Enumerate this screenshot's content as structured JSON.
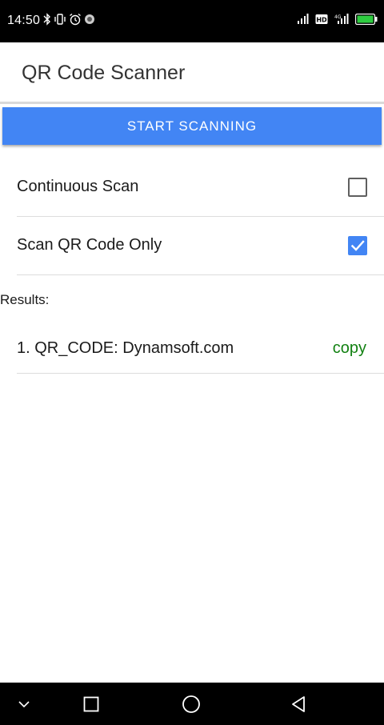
{
  "status_bar": {
    "time": "14:50",
    "left_icons": [
      "bluetooth-icon",
      "vibrate-icon",
      "alarm-icon",
      "record-icon"
    ],
    "right_icons": [
      "signal-icon",
      "hd-icon",
      "signal-4g-icon",
      "battery-icon"
    ],
    "battery_color": "#2ecc40"
  },
  "app_bar": {
    "title": "QR Code Scanner"
  },
  "scan_button": {
    "label": "START SCANNING",
    "color": "#4285f4"
  },
  "options": [
    {
      "label": "Continuous Scan",
      "checked": false
    },
    {
      "label": "Scan QR Code Only",
      "checked": true
    }
  ],
  "results": {
    "heading": "Results:",
    "items": [
      {
        "text": "1. QR_CODE: Dynamsoft.com",
        "action": "copy",
        "action_color": "#128112"
      }
    ]
  },
  "nav_bar": {
    "buttons": [
      "collapse-icon",
      "recents-icon",
      "home-icon",
      "back-icon"
    ]
  }
}
